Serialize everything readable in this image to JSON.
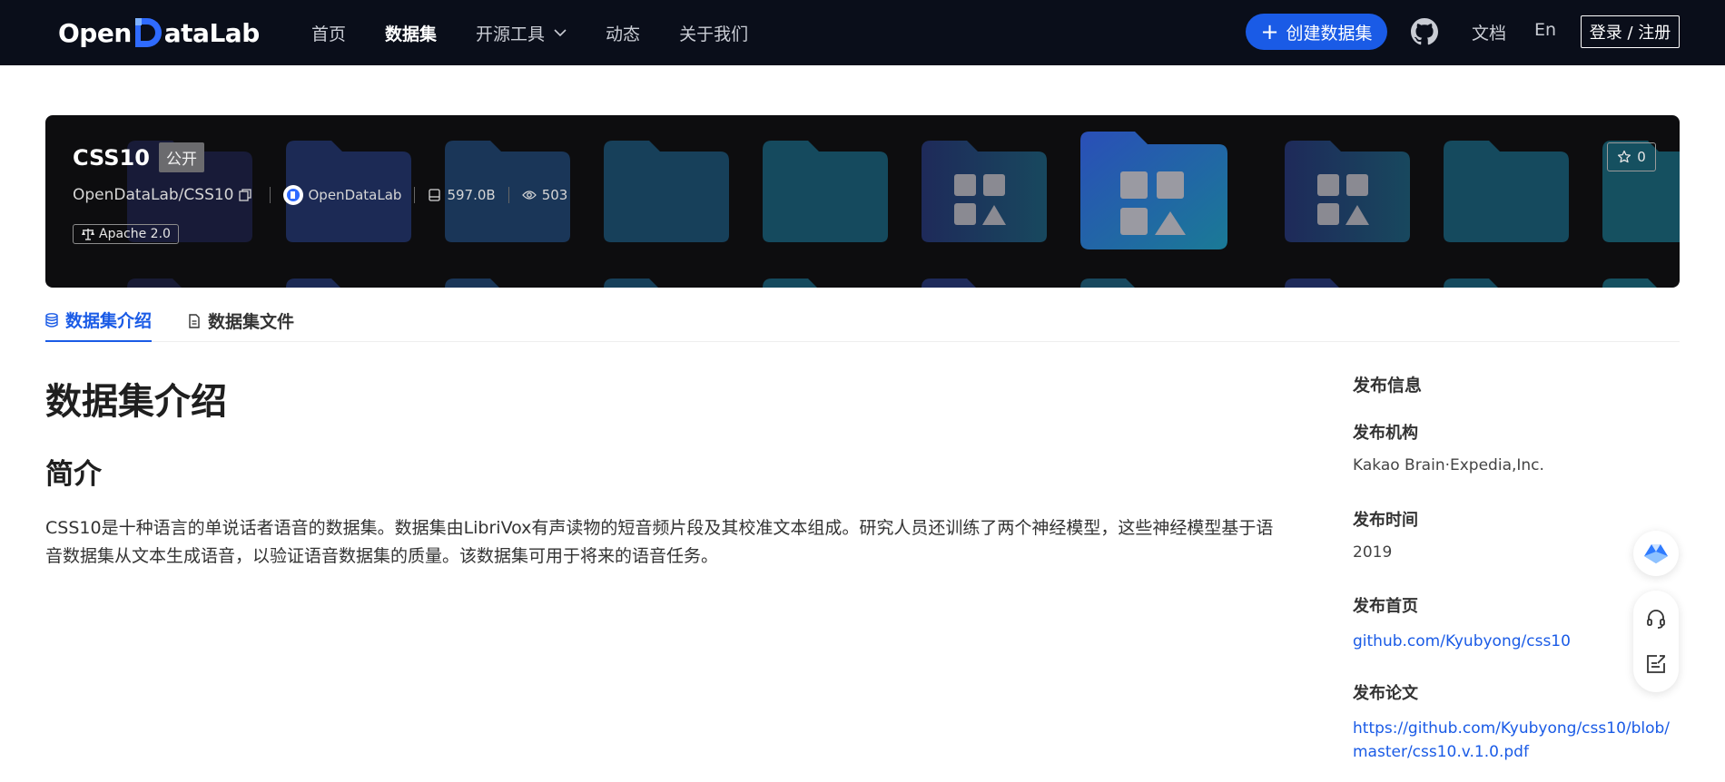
{
  "navbar": {
    "logo_prefix": "Open",
    "logo_suffix": "ataLab",
    "links": [
      {
        "label": "首页"
      },
      {
        "label": "数据集"
      },
      {
        "label": "开源工具"
      },
      {
        "label": "动态"
      },
      {
        "label": "关于我们"
      }
    ],
    "create_button": "创建数据集",
    "docs": "文档",
    "lang": "En",
    "login": "登录 / 注册"
  },
  "dataset": {
    "title": "CSS10",
    "visibility": "公开",
    "path": "OpenDataLab/CSS10",
    "org": "OpenDataLab",
    "size": "597.0B",
    "views": "503",
    "license": "Apache 2.0",
    "stars": "0"
  },
  "tabs": [
    {
      "label": "数据集介绍"
    },
    {
      "label": "数据集文件"
    }
  ],
  "main": {
    "heading": "数据集介绍",
    "subheading": "简介",
    "intro": "CSS10是十种语言的单说话者语音的数据集。数据集由LibriVox有声读物的短音频片段及其校准文本组成。研究人员还训练了两个神经模型，这些神经模型基于语音数据集从文本生成语音，以验证语音数据集的质量。该数据集可用于将来的语音任务。"
  },
  "sidebar": {
    "title": "发布信息",
    "org_label": "发布机构",
    "org_value": "Kakao Brain·Expedia,Inc.",
    "time_label": "发布时间",
    "time_value": "2019",
    "home_label": "发布首页",
    "home_value": "github.com/Kyubyong/css10",
    "paper_label": "发布论文",
    "paper_value": "https://github.com/Kyubyong/css10/blob/master/css10.v.1.0.pdf"
  },
  "colors": {
    "nav_bg": "#0a0e1a",
    "accent": "#1a5be6",
    "banner_bg": "#0d0d0f"
  },
  "icons": {
    "nav_dropdown": "chevron-down-icon",
    "create": "plus-icon",
    "github": "github-icon",
    "copy": "copy-icon",
    "org": "org-logo-icon",
    "size": "storage-icon",
    "views": "eye-icon",
    "license": "scale-icon",
    "star": "star-icon",
    "tab_intro": "database-icon",
    "tab_files": "file-icon",
    "float_top": "mountain-logo-icon",
    "float_support": "headset-icon",
    "float_feedback": "edit-note-icon"
  }
}
